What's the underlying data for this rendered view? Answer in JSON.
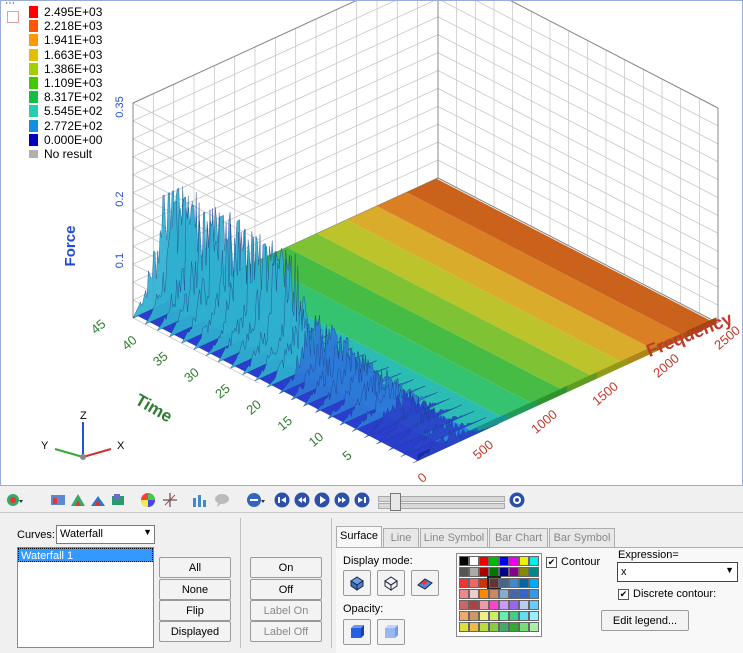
{
  "chart_data": {
    "type": "heatmap",
    "title": "",
    "xlabel": "Frequency",
    "ylabel": "Time",
    "zlabel": "Force",
    "xlim": [
      0,
      2500
    ],
    "ylim": [
      0,
      45
    ],
    "zlim": [
      0,
      0.35
    ],
    "x_ticks": [
      "0",
      "500",
      "1000",
      "1500",
      "2000",
      "2500"
    ],
    "y_ticks": [
      "5",
      "10",
      "15",
      "20",
      "25",
      "30",
      "35",
      "40",
      "45"
    ],
    "z_ticks": [
      "0.1",
      "0.2",
      "0.35"
    ],
    "legend_position": "top-left",
    "legend": [
      {
        "value": "2.495E+03",
        "color": "#ff0000"
      },
      {
        "value": "2.218E+03",
        "color": "#ff5500"
      },
      {
        "value": "1.941E+03",
        "color": "#ff9900"
      },
      {
        "value": "1.663E+03",
        "color": "#e0c000"
      },
      {
        "value": "1.386E+03",
        "color": "#a0d000"
      },
      {
        "value": "1.109E+03",
        "color": "#40c800"
      },
      {
        "value": "8.317E+02",
        "color": "#10c040"
      },
      {
        "value": "5.545E+02",
        "color": "#20d0b0"
      },
      {
        "value": "2.772E+02",
        "color": "#1090e0"
      },
      {
        "value": "0.000E+00",
        "color": "#0000c0"
      },
      {
        "value": "No result",
        "color": "#b0b0b0"
      }
    ],
    "band_colors": [
      "#1f33cc",
      "#1a7ee6",
      "#20b8b0",
      "#2ac068",
      "#3cb83a",
      "#78c02a",
      "#b8c020",
      "#d8a820",
      "#d87818",
      "#c85a10"
    ]
  },
  "triad": {
    "x": "X",
    "y": "Y",
    "z": "Z"
  },
  "panel": {
    "curves_label": "Curves:",
    "curves_value": "Waterfall",
    "curve_list": [
      "Waterfall 1"
    ],
    "buttons_left": [
      "All",
      "None",
      "Flip",
      "Displayed"
    ],
    "buttons_mid": [
      "On",
      "Off",
      "Label On",
      "Label Off"
    ],
    "tabs": [
      "Surface",
      "Line",
      "Line Symbol",
      "Bar Chart",
      "Bar Symbol"
    ],
    "display_mode_label": "Display mode:",
    "opacity_label": "Opacity:",
    "contour_label": "Contour",
    "expression_label": "Expression=",
    "expression_value": "x",
    "discrete_label": "Discrete contour:",
    "edit_legend": "Edit legend..."
  }
}
